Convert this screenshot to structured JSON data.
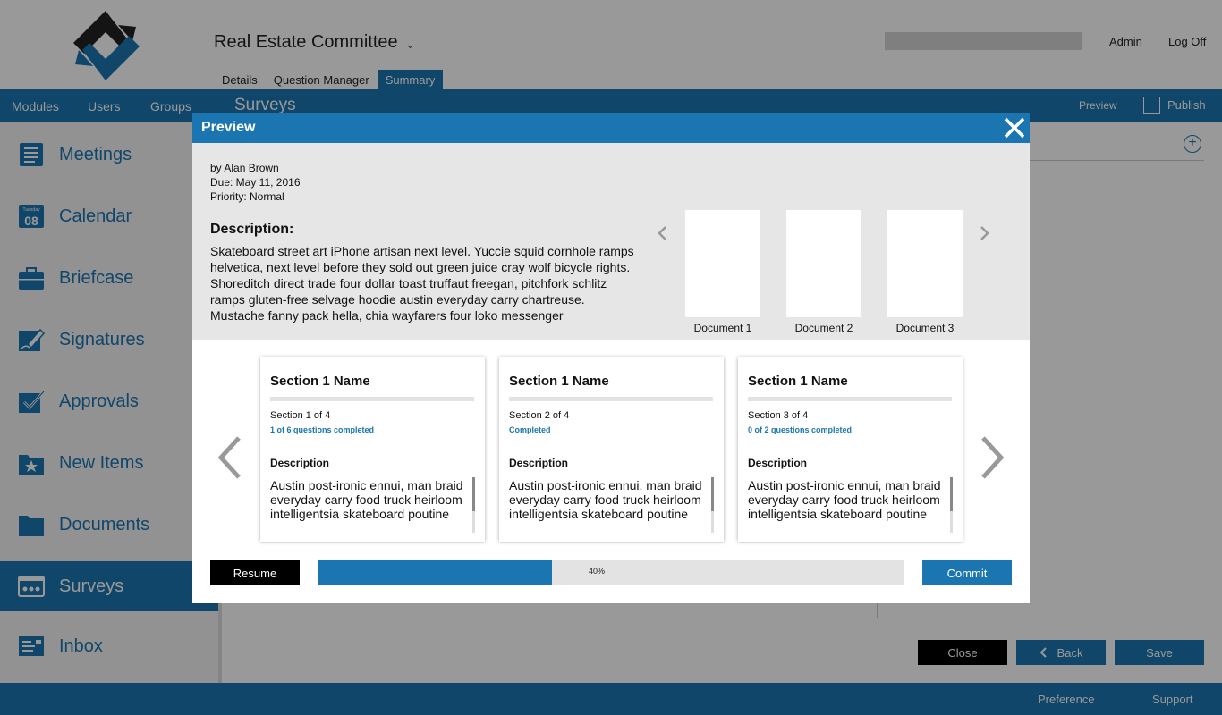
{
  "header": {
    "committee": "Real Estate Committee",
    "user": "Admin",
    "logoff": "Log Off",
    "subtabs": [
      "Details",
      "Question Manager",
      "Summary"
    ],
    "active_subtab": "Summary"
  },
  "navbar": {
    "items": [
      "Modules",
      "Users",
      "Groups"
    ],
    "page_title": "Surveys",
    "preview": "Preview",
    "publish": "Publish"
  },
  "sidebar": {
    "items": [
      {
        "label": "Meetings",
        "icon": "meetings-icon"
      },
      {
        "label": "Calendar",
        "icon": "calendar-icon",
        "icon_text_top": "Tuesday",
        "icon_text": "08"
      },
      {
        "label": "Briefcase",
        "icon": "briefcase-icon"
      },
      {
        "label": "Signatures",
        "icon": "signature-icon"
      },
      {
        "label": "Approvals",
        "icon": "approval-icon"
      },
      {
        "label": "New Items",
        "icon": "new-items-icon"
      },
      {
        "label": "Documents",
        "icon": "folder-icon"
      },
      {
        "label": "Surveys",
        "icon": "surveys-icon",
        "active": true
      },
      {
        "label": "Inbox",
        "icon": "inbox-icon"
      }
    ]
  },
  "actions": {
    "close": "Close",
    "back": "Back",
    "save": "Save"
  },
  "footer": {
    "preference": "Preference",
    "support": "Support"
  },
  "modal": {
    "title": "Preview",
    "author": "by Alan Brown",
    "due": "Due: May 11, 2016",
    "priority": "Priority: Normal",
    "description_heading": "Description:",
    "description": "Skateboard street art iPhone artisan next level. Yuccie squid cornhole ramps helvetica, next level before they sold out green juice cray wolf bicycle rights. Shoreditch direct trade four dollar toast truffaut freegan, pitchfork schlitz ramps gluten-free selvage hoodie austin everyday carry chartreuse. Mustache fanny pack hella, chia wayfarers four loko messenger",
    "documents": [
      "Document 1",
      "Document 2",
      "Document 3"
    ],
    "sections": [
      {
        "title": "Section 1 Name",
        "count": "Section 1 of 4",
        "status": "1 of 6 questions completed",
        "description_label": "Description",
        "description": "Austin post-ironic ennui, man braid everyday carry food truck heirloom intelligentsia skateboard poutine"
      },
      {
        "title": "Section 1 Name",
        "count": "Section 2 of 4",
        "status": "Completed",
        "description_label": "Description",
        "description": "Austin post-ironic ennui, man braid everyday carry food truck heirloom intelligentsia skateboard poutine"
      },
      {
        "title": "Section 1 Name",
        "count": "Section 3 of 4",
        "status": "0 of 2 questions completed",
        "description_label": "Description",
        "description": "Austin post-ironic ennui, man braid everyday carry food truck heirloom intelligentsia skateboard poutine"
      }
    ],
    "resume": "Resume",
    "progress_value": 40,
    "progress_label": "40%",
    "commit": "Commit"
  },
  "colors": {
    "primary": "#1b75b0",
    "dark": "#000000",
    "panel": "#e6e6e6"
  }
}
